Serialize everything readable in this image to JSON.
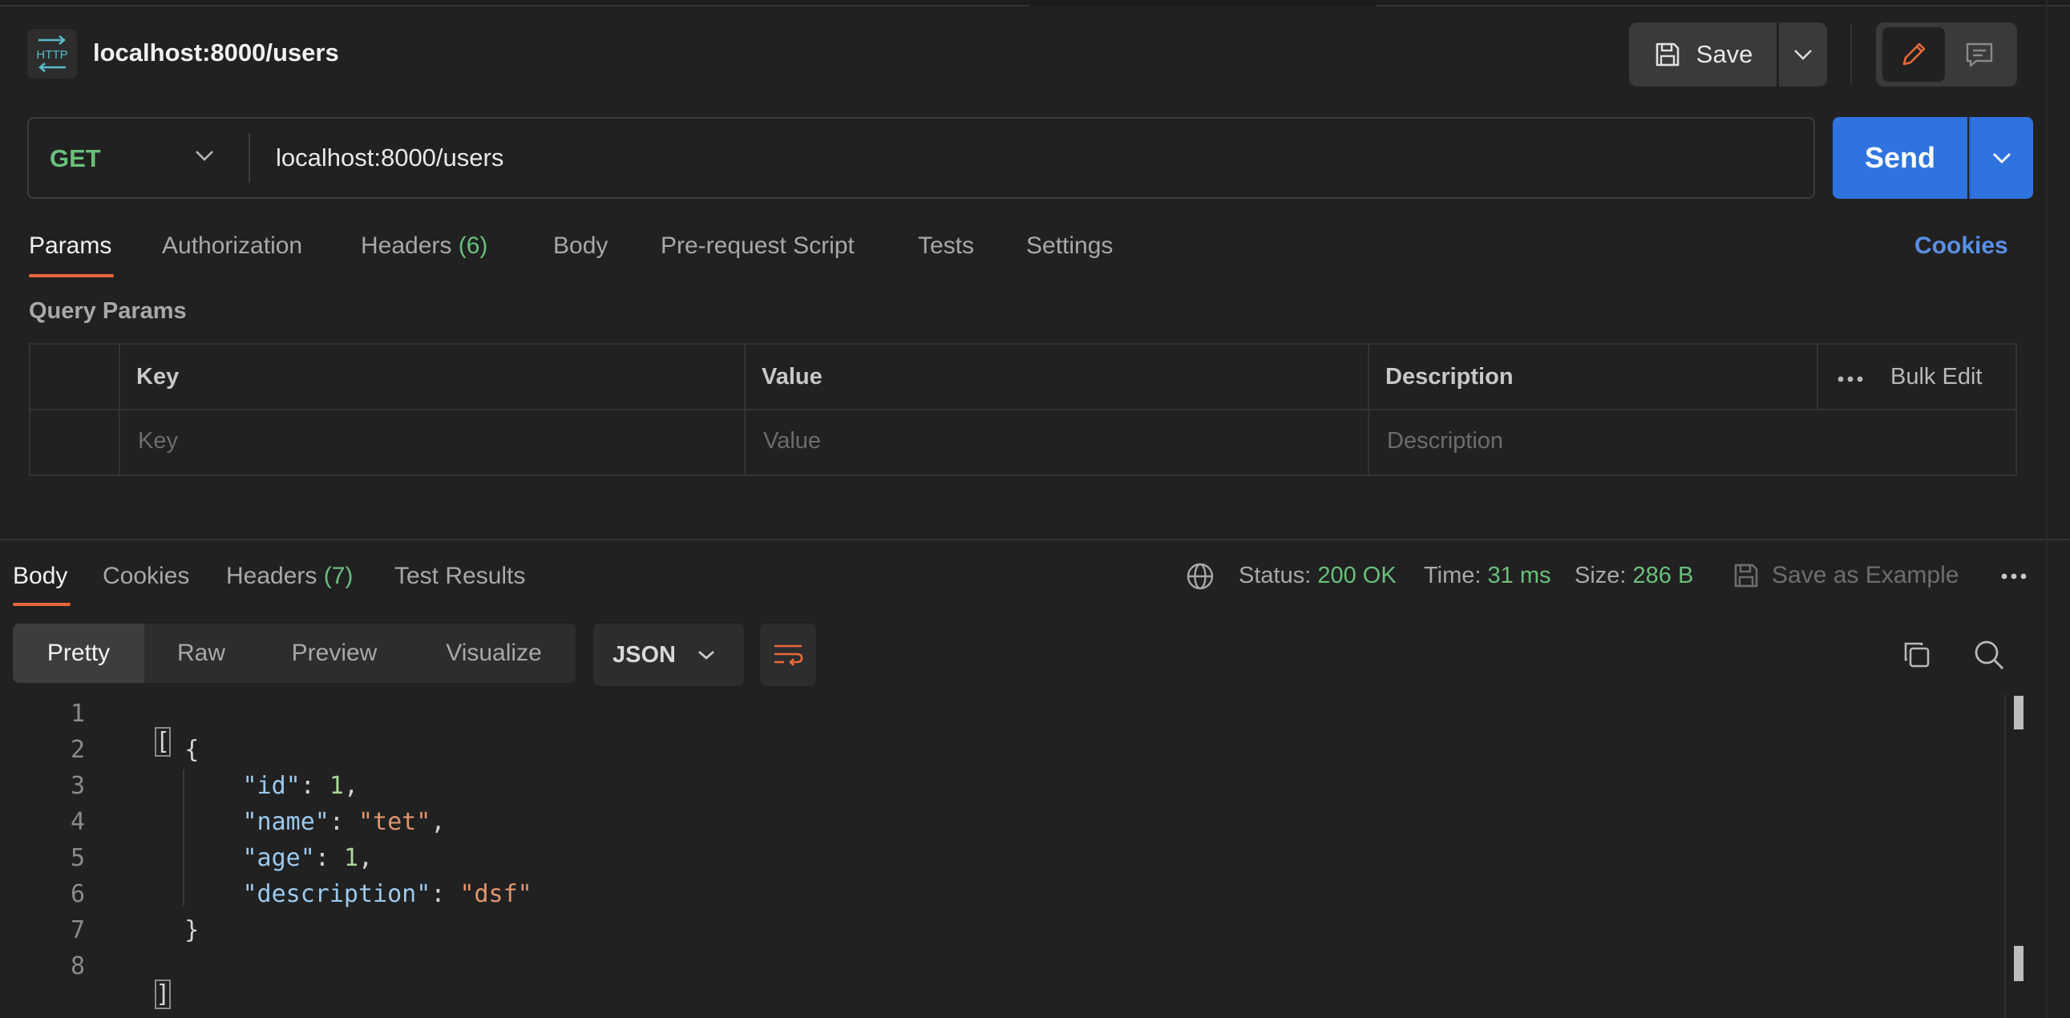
{
  "header": {
    "icon_text": "HTTP",
    "title": "localhost:8000/users",
    "save_label": "Save"
  },
  "request": {
    "method": "GET",
    "url": "localhost:8000/users",
    "send_label": "Send"
  },
  "request_tabs": {
    "params": "Params",
    "authorization": "Authorization",
    "headers": "Headers",
    "headers_count": "(6)",
    "body": "Body",
    "pre_request": "Pre-request Script",
    "tests": "Tests",
    "settings": "Settings",
    "cookies": "Cookies"
  },
  "query_params": {
    "title": "Query Params",
    "columns": {
      "key": "Key",
      "value": "Value",
      "description": "Description"
    },
    "bulk_edit": "Bulk Edit",
    "placeholders": {
      "key": "Key",
      "value": "Value",
      "description": "Description"
    }
  },
  "response_tabs": {
    "body": "Body",
    "cookies": "Cookies",
    "headers": "Headers",
    "headers_count": "(7)",
    "test_results": "Test Results"
  },
  "response_status": {
    "status_label": "Status:",
    "status_value": "200 OK",
    "time_label": "Time:",
    "time_value": "31 ms",
    "size_label": "Size:",
    "size_value": "286 B",
    "save_example": "Save as Example"
  },
  "view_modes": {
    "pretty": "Pretty",
    "raw": "Raw",
    "preview": "Preview",
    "visualize": "Visualize",
    "format": "JSON"
  },
  "code": {
    "line_numbers": [
      "1",
      "2",
      "3",
      "4",
      "5",
      "6",
      "7",
      "8"
    ],
    "lines": {
      "l1": "[",
      "l2": "{",
      "l3_key": "\"id\"",
      "l3_val": "1",
      "l4_key": "\"name\"",
      "l4_val": "\"tet\"",
      "l5_key": "\"age\"",
      "l5_val": "1",
      "l6_key": "\"description\"",
      "l6_val": "\"dsf\"",
      "l7": "}",
      "l8": "]"
    }
  },
  "icons": {
    "http": "http-icon",
    "save": "floppy-disk-icon",
    "edit": "pencil-icon",
    "comment": "comment-icon",
    "globe": "globe-icon",
    "copy": "copy-icon",
    "search": "search-icon",
    "wrap": "wrap-lines-icon"
  },
  "colors": {
    "accent": "#e8693a",
    "send": "#2f73e0",
    "success": "#6bbf7b",
    "link": "#5a8fe6"
  }
}
